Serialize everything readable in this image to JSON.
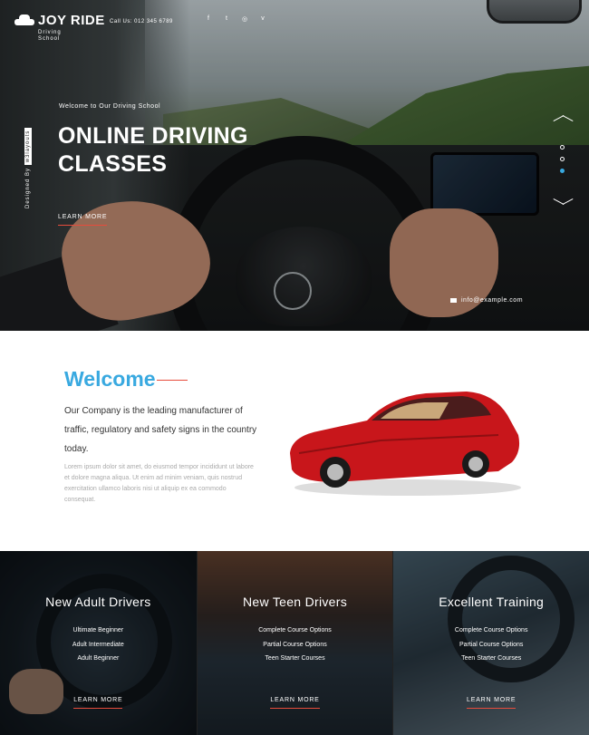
{
  "brand": {
    "name": "JOY RIDE",
    "subtitle": "Driving School"
  },
  "header": {
    "call": "Call Us: 012 345 6789",
    "social": [
      "f",
      "t",
      "◎",
      "v"
    ]
  },
  "hero": {
    "designed_by": "Designed By",
    "designer": "w3layouts",
    "welcome_small": "Welcome to Our Driving School",
    "title": "ONLINE DRIVING CLASSES",
    "cta": "LEARN MORE",
    "email": "info@example.com"
  },
  "welcome": {
    "title": "Welcome",
    "lead": "Our Company is the leading manufacturer of traffic, regulatory and safety signs in the country today.",
    "body": "Lorem ipsum dolor sit amet, do eiusmod tempor incididunt ut labore et dolore magna aliqua. Ut enim ad minim veniam, quis nostrud exercitation ullamco laboris nisi ut aliquip ex ea commodo consequat."
  },
  "cards": [
    {
      "title": "New Adult Drivers",
      "items": [
        "Ultimate Beginner",
        "Adult Intermediate",
        "Adult Beginner"
      ],
      "cta": "LEARN MORE"
    },
    {
      "title": "New Teen Drivers",
      "items": [
        "Complete Course Options",
        "Partial Course Options",
        "Teen Starter Courses"
      ],
      "cta": "LEARN MORE"
    },
    {
      "title": "Excellent Training",
      "items": [
        "Complete Course Options",
        "Partial Course Options",
        "Teen Starter Courses"
      ],
      "cta": "LEARN MORE"
    }
  ],
  "colors": {
    "accent_blue": "#39a9e0",
    "accent_red": "#e74c3c"
  },
  "icons": [
    "car-icon",
    "facebook-icon",
    "twitter-icon",
    "dribbble-icon",
    "vimeo-icon",
    "arrow-up-icon",
    "arrow-down-icon",
    "envelope-icon"
  ]
}
